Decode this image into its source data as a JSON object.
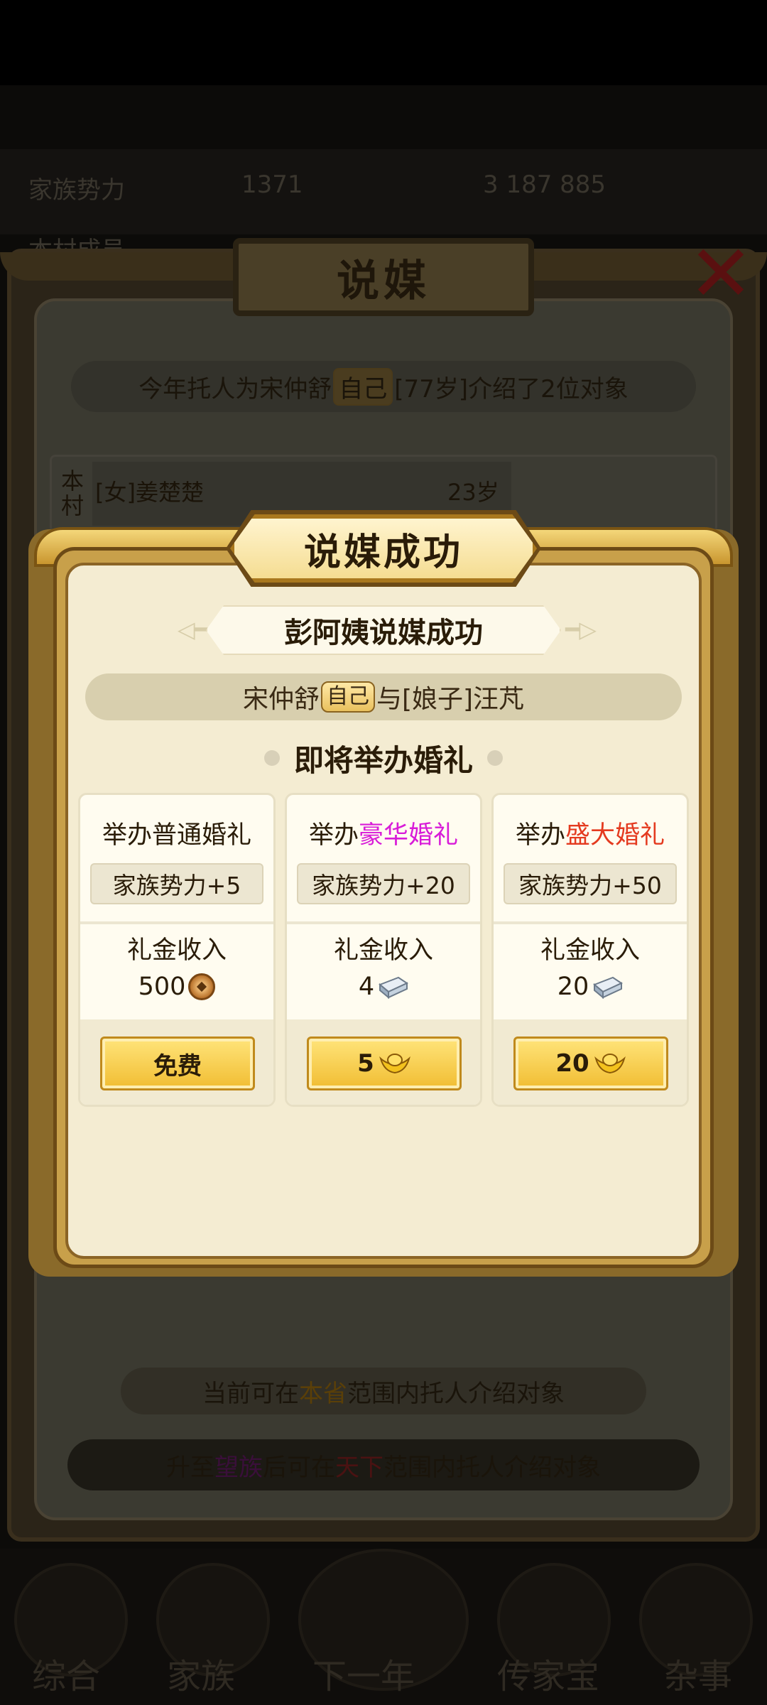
{
  "background": {
    "status_left": "家族势力",
    "status_value": "1371",
    "status_right": "3 187 885",
    "sub_left": "本村成员",
    "nav": [
      "综合",
      "家族",
      "下一年",
      "传家宝",
      "杂事"
    ]
  },
  "back_modal": {
    "title": "说媒",
    "summary": {
      "prefix": "今年托人为宋仲舒",
      "self_tag": "自己",
      "suffix": "[77岁]介绍了2位对象"
    },
    "row": {
      "tag_line1": "本",
      "tag_line2": "村",
      "name": "[女]姜楚楚",
      "age": "23岁"
    },
    "scope": {
      "prefix": "当前可在",
      "highlight": "本省",
      "suffix": "范围内托人介绍对象"
    },
    "upgrade": {
      "prefix": "升至",
      "rank": "望族",
      "middle": "后可在",
      "scope": "天下",
      "suffix": "范围内托人介绍对象"
    }
  },
  "success_modal": {
    "title": "说媒成功",
    "matchmaker_text": "彭阿姨说媒成功",
    "couple": {
      "name": "宋仲舒",
      "self_tag": "自己",
      "connector": "与",
      "partner": "[娘子]汪芃"
    },
    "heading": "即将举办婚礼",
    "options": [
      {
        "title_prefix": "举办普通婚礼",
        "title_highlight": "",
        "power": "家族势力+5",
        "gift_label": "礼金收入",
        "gift_amount": "500",
        "gift_icon": "copper-coin-icon",
        "button_label": "免费",
        "cost_icon": ""
      },
      {
        "title_prefix": "举办",
        "title_highlight": "豪华婚礼",
        "highlight_color": "#d81bd8",
        "power": "家族势力+20",
        "gift_label": "礼金收入",
        "gift_amount": "4",
        "gift_icon": "silver-ingot-icon",
        "button_label": "5",
        "cost_icon": "gold-ingot-icon"
      },
      {
        "title_prefix": "举办",
        "title_highlight": "盛大婚礼",
        "highlight_color": "#e43a1f",
        "power": "家族势力+50",
        "gift_label": "礼金收入",
        "gift_amount": "20",
        "gift_icon": "silver-ingot-icon",
        "button_label": "20",
        "cost_icon": "gold-ingot-icon"
      }
    ]
  }
}
